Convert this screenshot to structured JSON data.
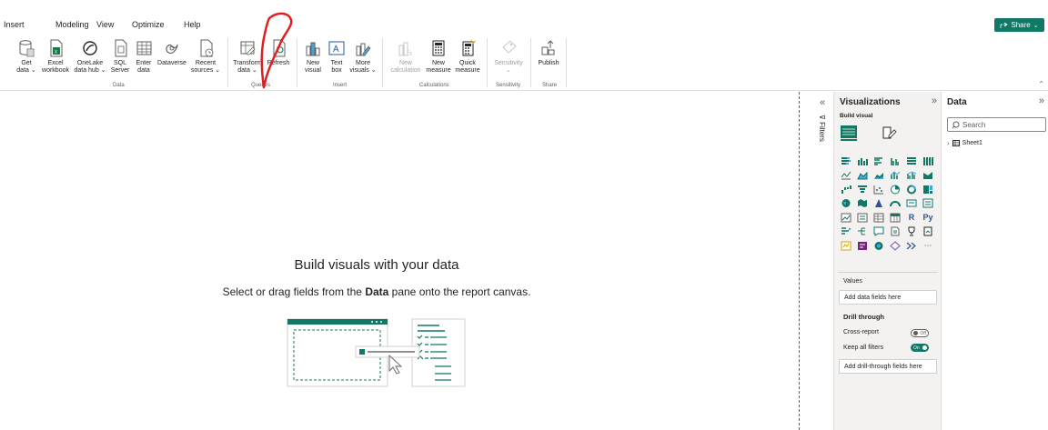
{
  "menu": {
    "items": [
      "Insert",
      "Modeling",
      "View",
      "Optimize",
      "Help"
    ],
    "share_label": "Share"
  },
  "ribbon": {
    "buttons": [
      {
        "id": "get-data",
        "label1": "Get",
        "label2": "data ⌄",
        "icon": "database-icon",
        "disabled": false
      },
      {
        "id": "excel",
        "label1": "Excel",
        "label2": "workbook",
        "icon": "excel-icon",
        "disabled": false
      },
      {
        "id": "onelake",
        "label1": "OneLake",
        "label2": "data hub ⌄",
        "icon": "onelake-icon",
        "disabled": false
      },
      {
        "id": "sql",
        "label1": "SQL",
        "label2": "Server",
        "icon": "sql-server-icon",
        "disabled": false
      },
      {
        "id": "enter-data",
        "label1": "Enter",
        "label2": "data",
        "icon": "table-icon",
        "disabled": false
      },
      {
        "id": "dataverse",
        "label1": "Dataverse",
        "label2": "",
        "icon": "dataverse-icon",
        "disabled": false
      },
      {
        "id": "recent",
        "label1": "Recent",
        "label2": "sources ⌄",
        "icon": "recent-sources-icon",
        "disabled": false
      },
      {
        "id": "transform",
        "label1": "Transform",
        "label2": "data ⌄",
        "icon": "transform-icon",
        "disabled": false
      },
      {
        "id": "refresh",
        "label1": "Refresh",
        "label2": "",
        "icon": "refresh-icon",
        "disabled": false
      },
      {
        "id": "new-visual",
        "label1": "New",
        "label2": "visual",
        "icon": "new-visual-icon",
        "disabled": false
      },
      {
        "id": "text-box",
        "label1": "Text",
        "label2": "box",
        "icon": "text-box-icon",
        "disabled": false
      },
      {
        "id": "more-visuals",
        "label1": "More",
        "label2": "visuals ⌄",
        "icon": "more-visuals-icon",
        "disabled": false
      },
      {
        "id": "new-calc",
        "label1": "New",
        "label2": "calculation",
        "icon": "calculation-icon",
        "disabled": true
      },
      {
        "id": "new-measure",
        "label1": "New",
        "label2": "measure",
        "icon": "calculator-icon",
        "disabled": false
      },
      {
        "id": "quick-measure",
        "label1": "Quick",
        "label2": "measure",
        "icon": "quick-measure-icon",
        "disabled": false
      },
      {
        "id": "sensitivity",
        "label1": "Sensitivity",
        "label2": "⌄",
        "icon": "sensitivity-icon",
        "disabled": true
      },
      {
        "id": "publish",
        "label1": "Publish",
        "label2": "",
        "icon": "publish-icon",
        "disabled": false
      }
    ],
    "groups": [
      "Data",
      "Queries",
      "Insert",
      "Calculations",
      "Sensitivity",
      "Share"
    ]
  },
  "canvas": {
    "title": "Build visuals with your data",
    "subtitle_pre": "Select or drag fields from the ",
    "subtitle_bold": "Data",
    "subtitle_post": " pane onto the report canvas."
  },
  "filters": {
    "label": "Filters"
  },
  "visualizations": {
    "title": "Visualizations",
    "build_visual": "Build visual",
    "values_label": "Values",
    "values_placeholder": "Add data fields here",
    "drill_title": "Drill through",
    "cross_report": "Cross-report",
    "cross_report_state": "Off",
    "keep_filters": "Keep all filters",
    "keep_filters_state": "On",
    "drill_placeholder": "Add drill-through fields here",
    "r_label": "R",
    "py_label": "Py",
    "more_label": "⋯"
  },
  "data": {
    "title": "Data",
    "search_placeholder": "Search",
    "tables": [
      "Sheet1"
    ]
  },
  "colors": {
    "accent": "#117865",
    "annotation": "#e02020"
  }
}
